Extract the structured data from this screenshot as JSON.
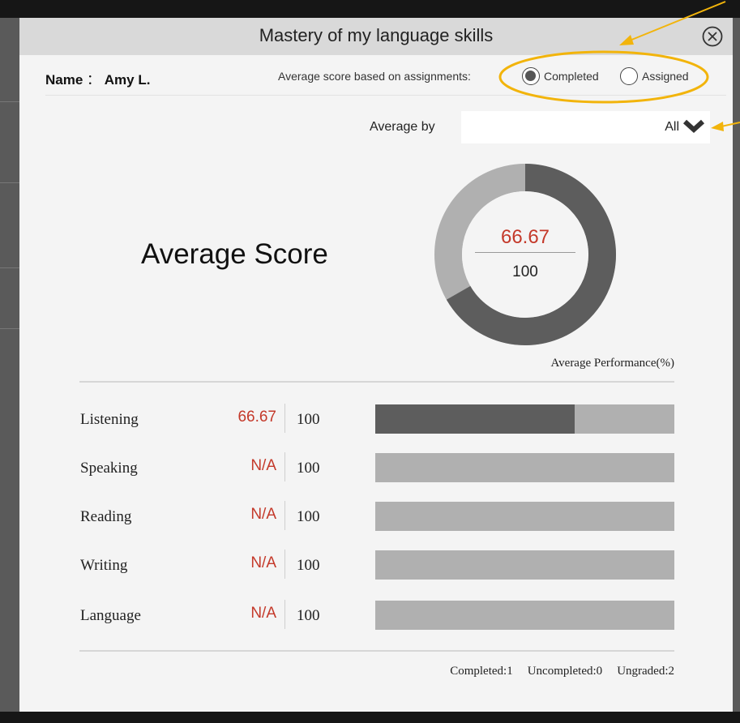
{
  "modal": {
    "title": "Mastery of my language skills"
  },
  "student": {
    "name_label": "Name",
    "name_sep": "：",
    "name": "Amy L."
  },
  "basis": {
    "label": "Average score based on assignments:",
    "options": [
      {
        "label": "Completed",
        "checked": true
      },
      {
        "label": "Assigned",
        "checked": false
      }
    ]
  },
  "average_by": {
    "label": "Average by",
    "value": "All"
  },
  "summary": {
    "title": "Average Score",
    "value": "66.67",
    "total": "100",
    "fraction": 0.6667,
    "performance_label": "Average Performance(%)"
  },
  "skills": [
    {
      "name": "Listening",
      "score": "66.67",
      "max": "100",
      "fraction": 0.6667
    },
    {
      "name": "Speaking",
      "score": "N/A",
      "max": "100",
      "fraction": 0
    },
    {
      "name": "Reading",
      "score": "N/A",
      "max": "100",
      "fraction": 0
    },
    {
      "name": "Writing",
      "score": "N/A",
      "max": "100",
      "fraction": 0
    },
    {
      "name": "Language",
      "score": "N/A",
      "max": "100",
      "fraction": 0
    }
  ],
  "stats": {
    "completed": "Completed:1",
    "uncompleted": "Uncompleted:0",
    "ungraded": "Ungraded:2"
  },
  "colors": {
    "accent_red": "#c4392a",
    "donut_fill": "#5d5d5d",
    "donut_track": "#b0b0b0",
    "annotation": "#f2b40b"
  },
  "icons": {
    "close": "close-circle-icon",
    "dropdown": "chevron-down-icon"
  }
}
